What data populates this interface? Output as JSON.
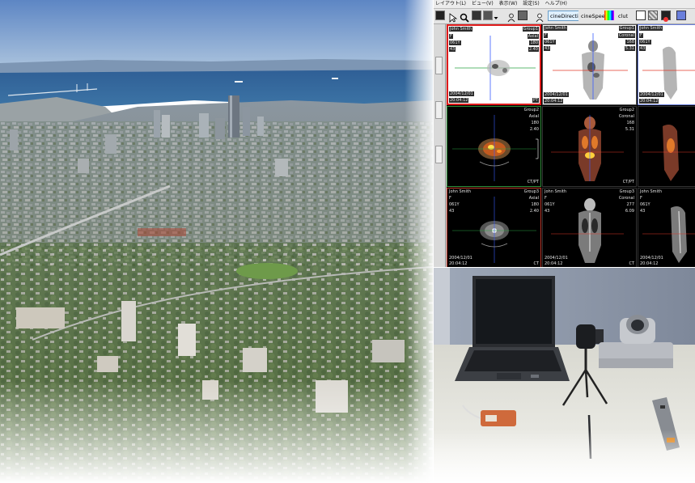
{
  "menu": {
    "items": [
      "レイアウト(L)",
      "ビュー(V)",
      "表示(W)",
      "設定(S)",
      "ヘルプ(H)"
    ]
  },
  "toolbar": {
    "cine_direction_label": "cineDirection",
    "cine_speed_label": "cineSpeed",
    "clut_label": "clut"
  },
  "icons": {
    "window_icon": "app-window-icon",
    "pointer": "pointer-arrow-icon",
    "zoom": "magnifier-icon",
    "layout": "layout-grid-icon",
    "dropdown": "chevron-down-icon"
  },
  "colors": {
    "active_viewport_border": "#e01b1b",
    "group2_border": "#2f8f3a",
    "group3_border": "#c0392b",
    "crosshair_h": "#e03a2a",
    "crosshair_v": "#3a5cff"
  },
  "viewports": [
    {
      "patient": "John Smith",
      "sex": "F",
      "age": "061Y",
      "id": "43",
      "group": "Group1",
      "orientation": "Axial",
      "v1": "180",
      "v2": "2.40",
      "date": "2004/12/01",
      "time": "20:04:12",
      "modality": "PT"
    },
    {
      "patient": "John Smith",
      "sex": "F",
      "age": "061Y",
      "id": "43",
      "group": "Group1",
      "orientation": "Coronal",
      "v1": "168",
      "v2": "5.31",
      "date": "2004/12/01",
      "time": "20:04:12",
      "modality": ""
    },
    {
      "patient": "John Smith",
      "sex": "F",
      "age": "061Y",
      "id": "43",
      "group": "",
      "orientation": "",
      "v1": "",
      "v2": "",
      "date": "2004/12/01",
      "time": "20:04:12",
      "modality": ""
    },
    {
      "patient": "",
      "sex": "",
      "age": "",
      "id": "",
      "group": "Group2",
      "orientation": "Axial",
      "v1": "180",
      "v2": "2.40",
      "date": "",
      "time": "",
      "modality": "CT/PT"
    },
    {
      "patient": "",
      "sex": "",
      "age": "",
      "id": "",
      "group": "Group2",
      "orientation": "Coronal",
      "v1": "168",
      "v2": "5.31",
      "date": "",
      "time": "",
      "modality": "CT/PT"
    },
    {
      "patient": "",
      "sex": "",
      "age": "",
      "id": "",
      "group": "",
      "orientation": "",
      "v1": "",
      "v2": "",
      "date": "",
      "time": "",
      "modality": ""
    },
    {
      "patient": "John Smith",
      "sex": "F",
      "age": "061Y",
      "id": "43",
      "group": "Group3",
      "orientation": "Axial",
      "v1": "180",
      "v2": "2.40",
      "date": "2004/12/01",
      "time": "20:04:12",
      "modality": "CT"
    },
    {
      "patient": "John Smith",
      "sex": "F",
      "age": "061Y",
      "id": "43",
      "group": "Group3",
      "orientation": "Coronal",
      "v1": "277",
      "v2": "6.09",
      "date": "2004/12/01",
      "time": "20:04:12",
      "modality": "CT"
    },
    {
      "patient": "John Smith",
      "sex": "F",
      "age": "061Y",
      "id": "43",
      "group": "",
      "orientation": "",
      "v1": "",
      "v2": "",
      "date": "2004/12/01",
      "time": "20:04:12",
      "modality": ""
    }
  ]
}
